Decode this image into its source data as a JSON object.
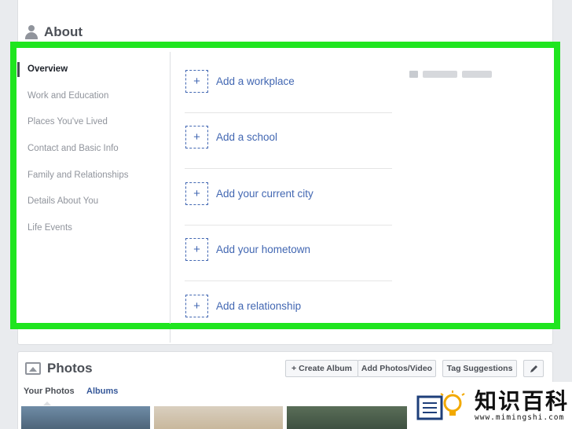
{
  "about": {
    "title": "About",
    "nav": [
      {
        "label": "Overview",
        "active": true
      },
      {
        "label": "Work and Education",
        "active": false
      },
      {
        "label": "Places You've Lived",
        "active": false
      },
      {
        "label": "Contact and Basic Info",
        "active": false
      },
      {
        "label": "Family and Relationships",
        "active": false
      },
      {
        "label": "Details About You",
        "active": false
      },
      {
        "label": "Life Events",
        "active": false
      }
    ],
    "add_items": [
      {
        "label": "Add a workplace"
      },
      {
        "label": "Add a school"
      },
      {
        "label": "Add your current city"
      },
      {
        "label": "Add your hometown"
      },
      {
        "label": "Add a relationship"
      }
    ],
    "plus_glyph": "+"
  },
  "photos": {
    "title": "Photos",
    "buttons": {
      "create_album": "Create Album",
      "add_photos_video": "Add Photos/Video",
      "tag_suggestions": "Tag Suggestions"
    },
    "tabs": {
      "your_photos": "Your Photos",
      "albums": "Albums"
    }
  },
  "watermark": {
    "text": "知识百科",
    "url": "www.mimingshi.com"
  },
  "colors": {
    "highlight": "#1fe51f",
    "link": "#4267b2",
    "muted": "#90949c"
  }
}
